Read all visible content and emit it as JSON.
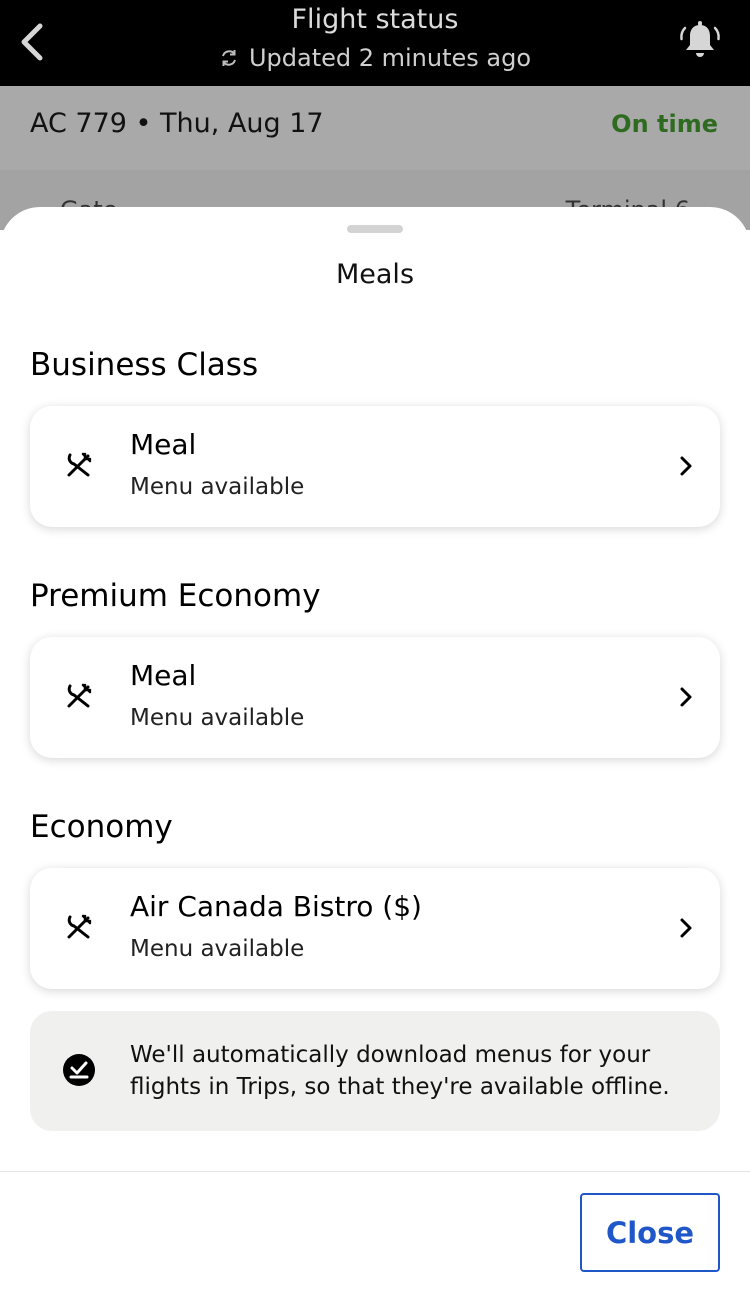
{
  "header": {
    "title": "Flight status",
    "updated": "Updated 2 minutes ago"
  },
  "flight": {
    "id": "AC 779 • Thu, Aug 17",
    "status": "On time",
    "status_color": "#2e6a1f",
    "partial_left": "Gate",
    "partial_right": "Terminal 6"
  },
  "sheet": {
    "title": "Meals",
    "sections": [
      {
        "title": "Business Class",
        "item_title": "Meal",
        "item_sub": "Menu available"
      },
      {
        "title": "Premium Economy",
        "item_title": "Meal",
        "item_sub": "Menu available"
      },
      {
        "title": "Economy",
        "item_title": "Air Canada Bistro ($)",
        "item_sub": "Menu available"
      }
    ],
    "notice": "We'll automatically download menus for your flights in Trips, so that they're available offline."
  },
  "footer": {
    "close_label": "Close"
  },
  "colors": {
    "accent": "#1f57c9",
    "header_bg": "#000000",
    "notice_bg": "#f0f0ef"
  },
  "icons": {
    "back": "chevron-left-icon",
    "bell": "bell-icon",
    "refresh": "refresh-icon",
    "meal": "utensils-icon",
    "chevron": "chevron-right-icon",
    "offline": "download-check-icon"
  }
}
